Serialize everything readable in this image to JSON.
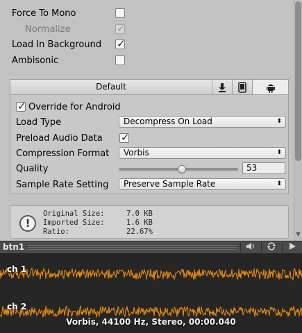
{
  "settings": {
    "force_to_mono": {
      "label": "Force To Mono",
      "checked": false
    },
    "normalize": {
      "label": "Normalize",
      "checked": true,
      "disabled": true
    },
    "load_in_background": {
      "label": "Load In Background",
      "checked": true
    },
    "ambisonic": {
      "label": "Ambisonic",
      "checked": false
    }
  },
  "platform_tabs": {
    "default_label": "Default",
    "icons": [
      "download-icon",
      "mobile-device-icon",
      "android-icon"
    ],
    "active": "android-icon"
  },
  "android": {
    "override": {
      "label": "Override for Android",
      "checked": true
    },
    "load_type": {
      "label": "Load Type",
      "value": "Decompress On Load"
    },
    "preload_audio_data": {
      "label": "Preload Audio Data",
      "checked": true
    },
    "compression_format": {
      "label": "Compression Format",
      "value": "Vorbis"
    },
    "quality": {
      "label": "Quality",
      "value": "53",
      "level_percent": 53
    },
    "sample_rate_setting": {
      "label": "Sample Rate Setting",
      "value": "Preserve Sample Rate"
    }
  },
  "info": {
    "original_size_label": "Original Size:",
    "original_size_value": "7.0 KB",
    "imported_size_label": "Imported Size:",
    "imported_size_value": "1.6 KB",
    "ratio_label": "Ratio:",
    "ratio_value": "22.67%"
  },
  "preview": {
    "title": "btn1",
    "buttons": [
      "speaker-icon",
      "loop-icon",
      "play-icon"
    ]
  },
  "waveform": {
    "channels": [
      "ch 1",
      "ch 2"
    ],
    "summary": "Vorbis, 44100 Hz, Stereo, 00:00.040",
    "wave_color": "#f0920f"
  }
}
